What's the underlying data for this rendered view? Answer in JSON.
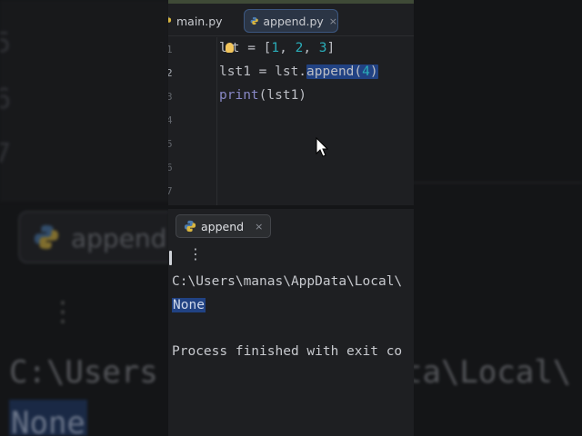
{
  "editor_tabs": [
    {
      "label": "main.py",
      "active": false
    },
    {
      "label": "append.py",
      "active": true,
      "close": "×"
    }
  ],
  "line_numbers": [
    "1",
    "2",
    "3",
    "4",
    "5",
    "6",
    "7"
  ],
  "code": {
    "line1": {
      "a": "l",
      "b": "t = [",
      "n1": "1",
      "s1": ", ",
      "n2": "2",
      "s2": ", ",
      "n3": "3",
      "end": "]"
    },
    "line2": {
      "prefix": "lst1 = lst.",
      "call": "append(",
      "arg": "4",
      "close": ")"
    },
    "line3": {
      "fn": "print",
      "rest": "(lst1)"
    }
  },
  "run_panel": {
    "tab_label": "append",
    "close": "×",
    "menu_glyph": "⋮"
  },
  "console": {
    "path": "C:\\Users\\manas\\AppData\\Local\\",
    "result": "None",
    "finished": "Process finished with exit co"
  },
  "backdrop": {
    "gutter": [
      "5",
      "6",
      "7"
    ],
    "tab_label": "append",
    "menu_glyph": "⋮",
    "path_left": "C:\\Users",
    "path_right": "ta\\Local\\",
    "result": "None"
  },
  "colors": {
    "background": "#1e1f22",
    "selection": "#214283",
    "number": "#2aacb8",
    "builtin": "#8888c6",
    "text": "#bcbec4"
  }
}
